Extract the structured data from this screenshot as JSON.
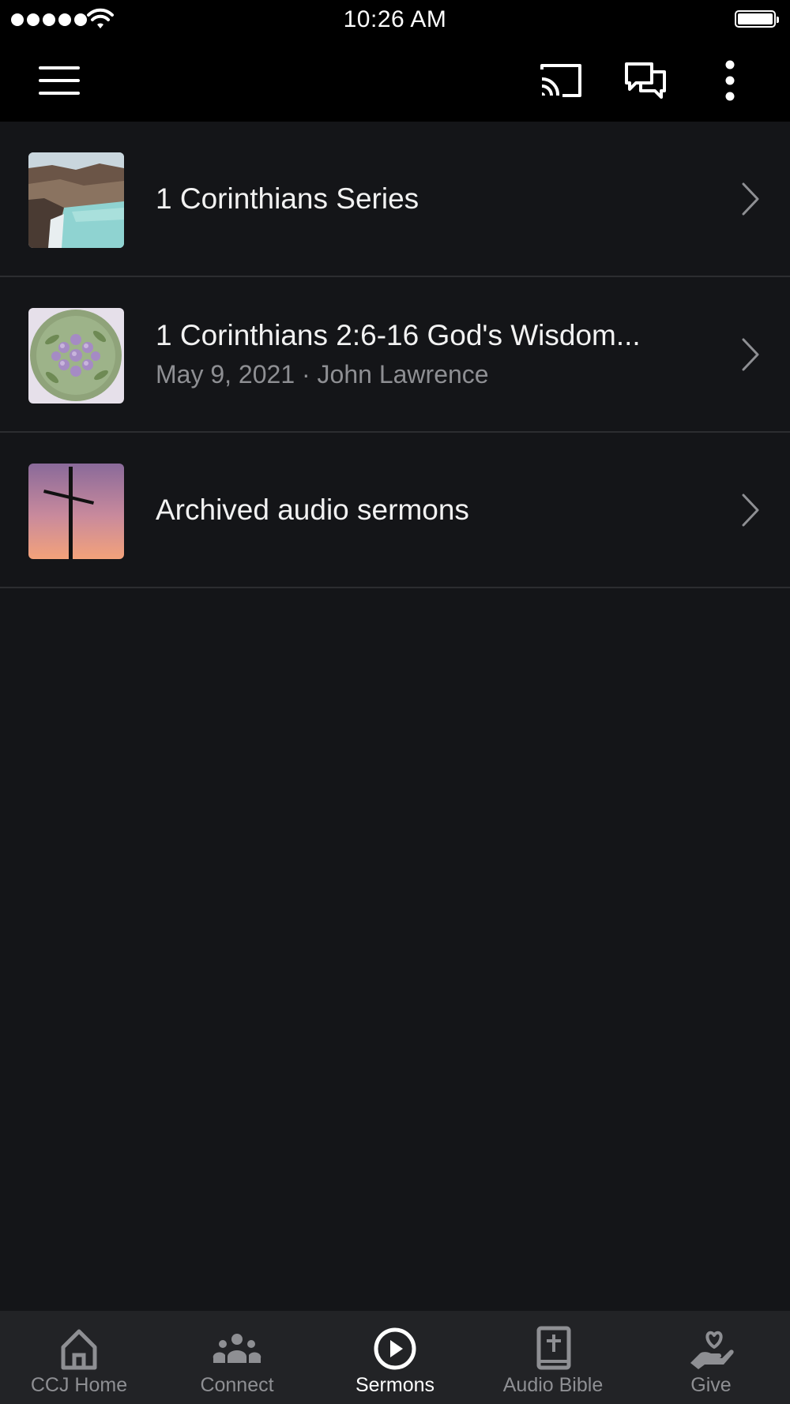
{
  "status_bar": {
    "time": "10:26 AM"
  },
  "app_bar": {
    "menu_icon": "hamburger-menu-icon",
    "cast_icon": "cast-icon",
    "chat_icon": "chat-bubbles-icon",
    "more_icon": "more-vertical-icon"
  },
  "list": {
    "items": [
      {
        "title": "1 Corinthians Series",
        "subtitle": "",
        "thumbnail": "lake-landscape-image"
      },
      {
        "title": "1 Corinthians 2:6-16   God's Wisdom...",
        "subtitle": "May 9, 2021 · John Lawrence",
        "thumbnail": "purple-flowers-image"
      },
      {
        "title": "Archived audio sermons",
        "subtitle": "",
        "thumbnail": "cross-sunset-image"
      }
    ]
  },
  "tabs": [
    {
      "label": "CCJ Home",
      "icon": "home-icon",
      "active": false
    },
    {
      "label": "Connect",
      "icon": "people-group-icon",
      "active": false
    },
    {
      "label": "Sermons",
      "icon": "play-circle-icon",
      "active": true
    },
    {
      "label": "Audio Bible",
      "icon": "bible-icon",
      "active": false
    },
    {
      "label": "Give",
      "icon": "heart-hand-icon",
      "active": false
    }
  ],
  "colors": {
    "background": "#141518",
    "app_bar": "#000000",
    "tab_bar": "#222326",
    "inactive": "#8e8f93",
    "active": "#ffffff"
  }
}
